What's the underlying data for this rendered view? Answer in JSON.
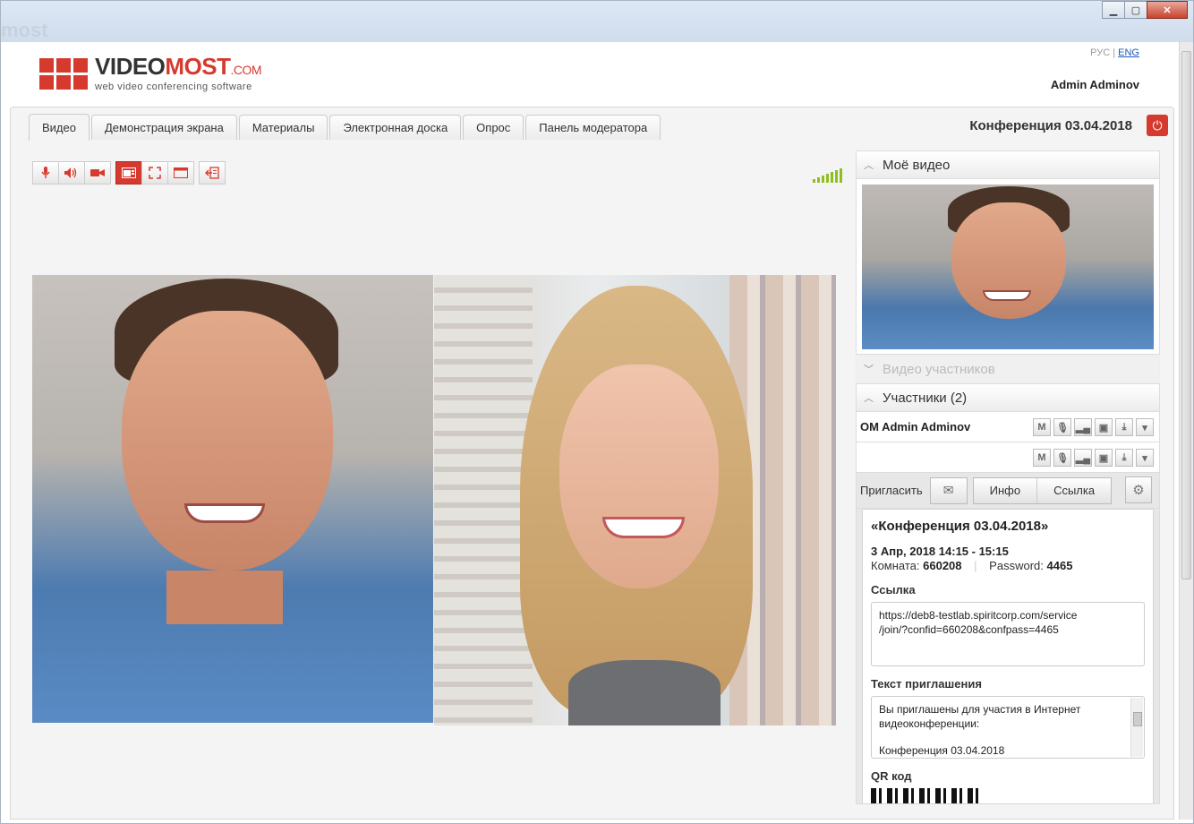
{
  "window": {
    "ghost_title": "most"
  },
  "header": {
    "logo_main": "VIDEO",
    "logo_red": "MOST",
    "logo_domain": ".COM",
    "logo_tagline": "web video conferencing software",
    "lang_rus": "РУС",
    "lang_sep": "|",
    "lang_eng": "ENG",
    "user_name": "Admin Adminov"
  },
  "tabs": [
    {
      "label": "Видео"
    },
    {
      "label": "Демонстрация экрана"
    },
    {
      "label": "Материалы"
    },
    {
      "label": "Электронная доска"
    },
    {
      "label": "Опрос"
    },
    {
      "label": "Панель модератора"
    }
  ],
  "conference": {
    "title": "Конференция 03.04.2018"
  },
  "panels": {
    "my_video": "Моё видео",
    "participants_video": "Видео участников",
    "participants": "Участники (2)"
  },
  "participants": [
    {
      "name": "OM Admin Adminov"
    },
    {
      "name": ""
    }
  ],
  "invite": {
    "label": "Пригласить",
    "info": "Инфо",
    "link": "Ссылка"
  },
  "info": {
    "title": "«Конференция 03.04.2018»",
    "date": "3 Апр, 2018 14:15 - 15:15",
    "room_label": "Комната:",
    "room": "660208",
    "password_label": "Password:",
    "password": "4465",
    "link_label": "Ссылка",
    "link_line1": "https://deb8-testlab.spiritcorp.com/service",
    "link_line2": "/join/?confid=660208&confpass=4465",
    "invite_text_label": "Текст приглашения",
    "invite_line1": "Вы приглашены для участия в Интернет",
    "invite_line2": "видеоконференции:",
    "invite_line3": "Конференция 03.04.2018",
    "qr_label": "QR код"
  },
  "colors": {
    "accent": "#d63a2f",
    "signal": "#8fbf1e"
  }
}
